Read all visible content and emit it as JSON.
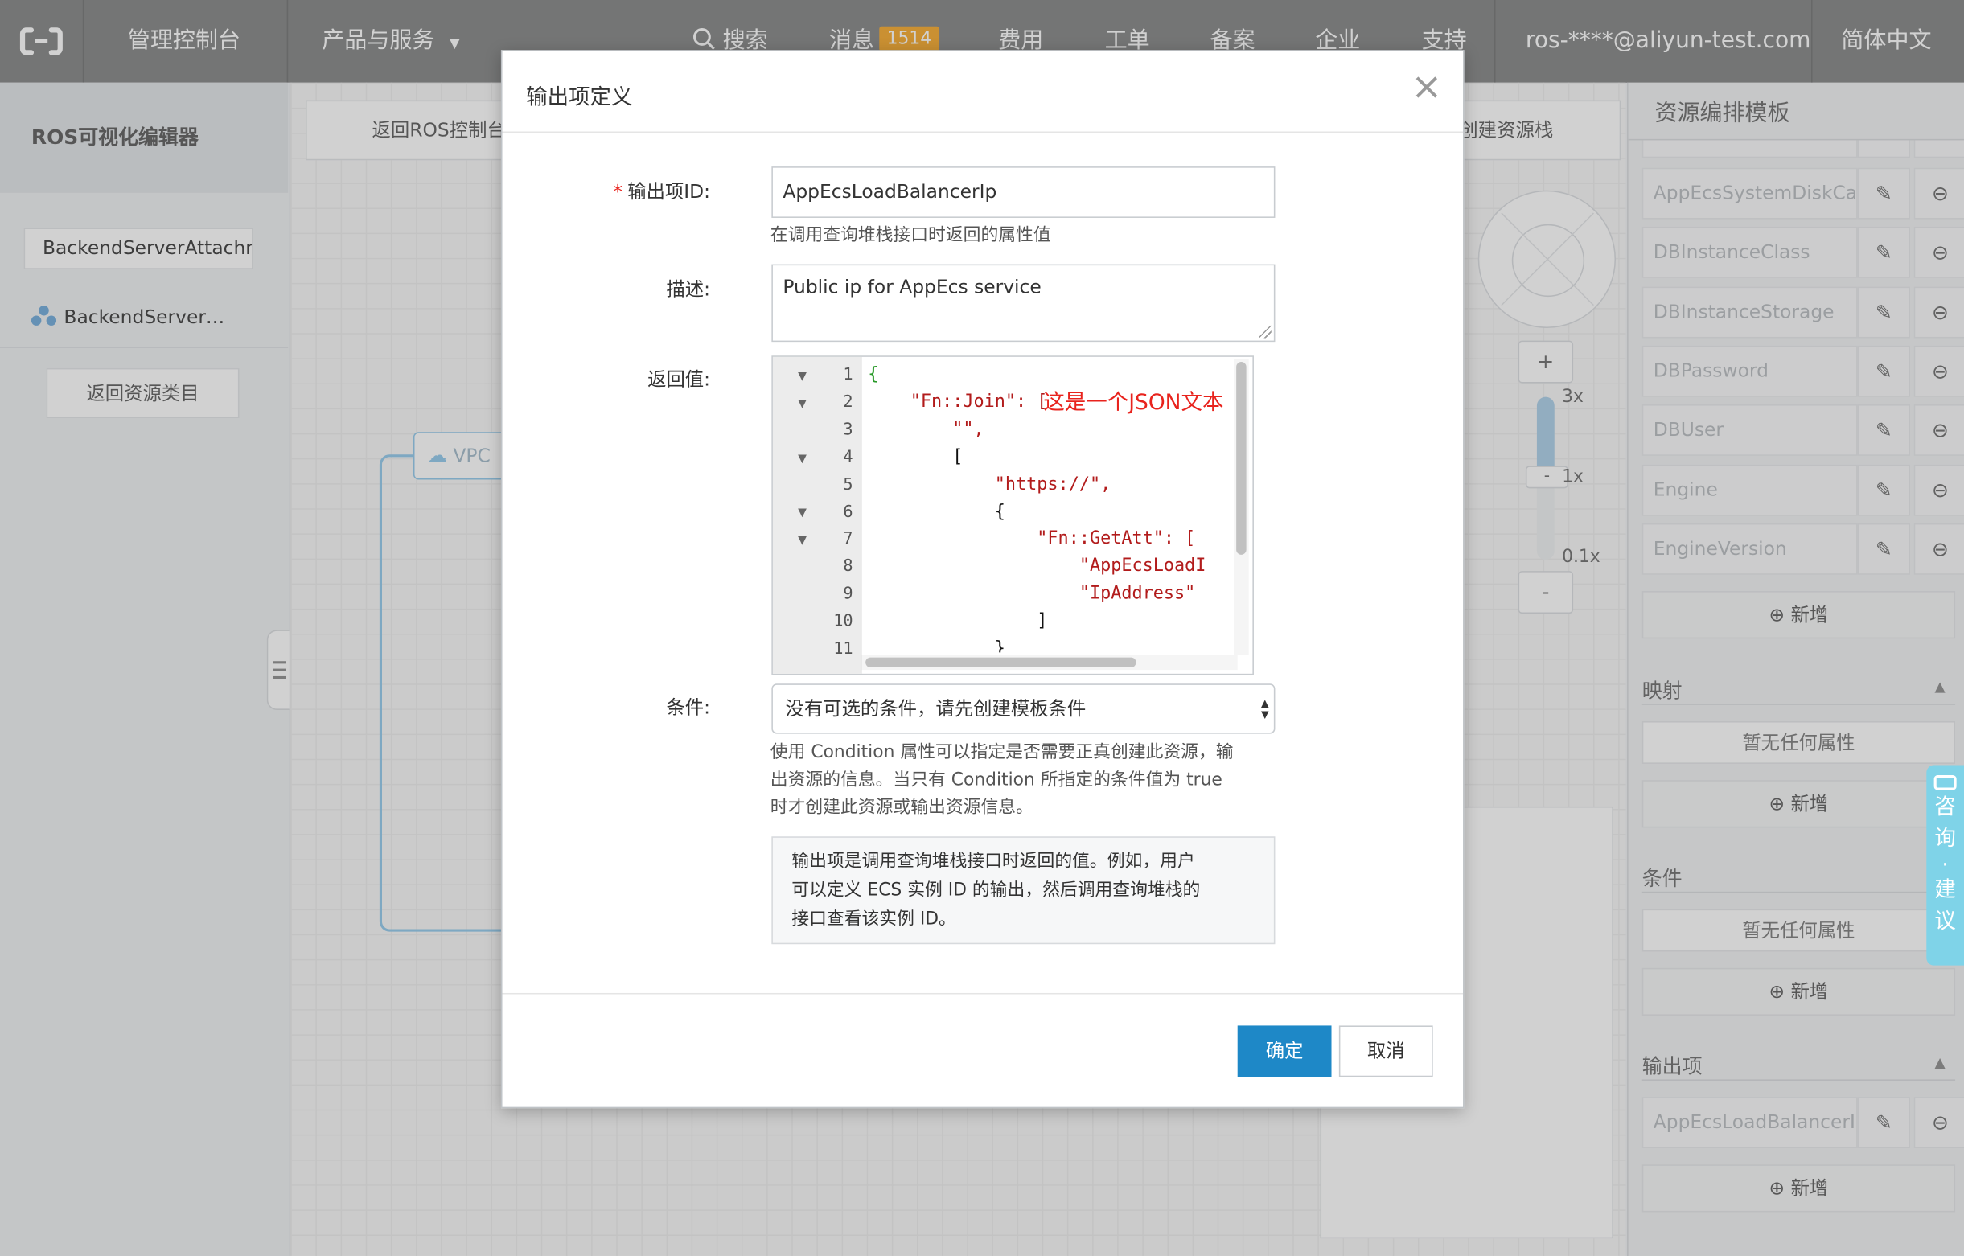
{
  "colors": {
    "primary": "#1e88c7",
    "nav_bg": "#7f8080",
    "badge": "#f5a623",
    "annotation": "#e8231d",
    "code_string": "#b21b1b",
    "float_tab": "#7fd3e8"
  },
  "topnav": {
    "logo_icon": "aliyun-logo-icon",
    "console": "管理控制台",
    "products": "产品与服务",
    "search": "搜索",
    "messages": "消息",
    "messages_count": "1514",
    "billing": "费用",
    "tickets": "工单",
    "filing": "备案",
    "enterprise": "企业",
    "support": "支持",
    "account": "ros-****@aliyun-test.com",
    "language": "简体中文"
  },
  "sidebar": {
    "title": "ROS可视化编辑器",
    "resource_input": "BackendServerAttachr",
    "resource_item": "BackendServer…",
    "back_button": "返回资源类目"
  },
  "canvas": {
    "back_ros": "返回ROS控制台",
    "create_stack": "创建资源栈",
    "vpc_label": "VPC",
    "zoom_in": "+",
    "zoom_out": "-",
    "zoom_3x": "3x",
    "zoom_1x": "1x",
    "zoom_01x": "0.1x",
    "handle_minus": "-"
  },
  "rightpanel": {
    "title": "资源编排模板",
    "params": [
      "AppEcsSystemDiskCa",
      "DBInstanceClass",
      "DBInstanceStorage",
      "DBPassword",
      "DBUser",
      "Engine",
      "EngineVersion"
    ],
    "add": "新增",
    "mapping": "映射",
    "condition": "条件",
    "outputs": "输出项",
    "no_props": "暂无任何属性",
    "output_items": [
      "AppEcsLoadBalancerI"
    ]
  },
  "float_tab": {
    "chars": [
      "咨",
      "询",
      "·",
      "建",
      "议"
    ]
  },
  "modal": {
    "title": "输出项定义",
    "required_mark": "*",
    "id_label": "输出项ID:",
    "id_value": "AppEcsLoadBalancerIp",
    "id_hint": "在调用查询堆栈接口时返回的属性值",
    "desc_label": "描述:",
    "desc_value": "Public ip for AppEcs service",
    "value_label": "返回值:",
    "annotation": "这是一个JSON文本",
    "code_line_numbers": [
      "1",
      "2",
      "3",
      "4",
      "5",
      "6",
      "7",
      "8",
      "9",
      "10",
      "11"
    ],
    "code_lines": [
      "{",
      "    \"Fn::Join\": [",
      "        \"\",",
      "        [",
      "            \"https://\",",
      "            {",
      "                \"Fn::GetAtt\": [",
      "                    \"AppEcsLoadI",
      "                    \"IpAddress\"",
      "                ]",
      "            }"
    ],
    "cond_label": "条件:",
    "cond_value": "没有可选的条件，请先创建模板条件",
    "cond_hint_1": "使用 Condition 属性可以指定是否需要正真创建此资源，输",
    "cond_hint_2": "出资源的信息。当只有 Condition 所指定的条件值为 true",
    "cond_hint_3": "时才创建此资源或输出资源信息。",
    "info_1": "输出项是调用查询堆栈接口时返回的值。例如，用户",
    "info_2": "可以定义 ECS 实例 ID 的输出，然后调用查询堆栈的",
    "info_3": "接口查看该实例 ID。",
    "confirm": "确定",
    "cancel": "取消"
  }
}
